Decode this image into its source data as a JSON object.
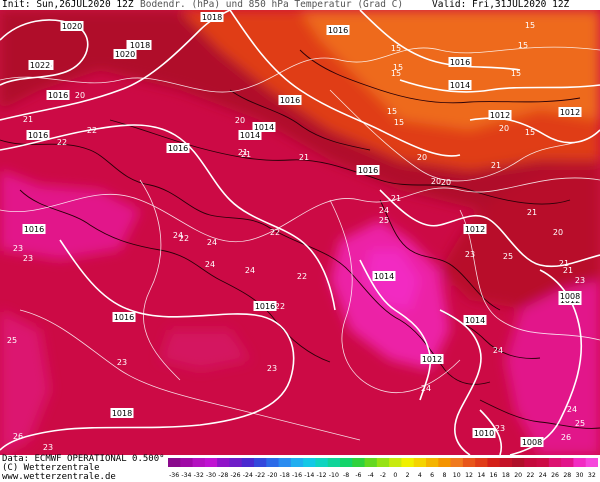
{
  "header": {
    "init": "Init: Sun,26JUL2020 12Z",
    "title": "Bodendr. (hPa) und 850 hPa Temperatur (Grad C)",
    "valid": "Valid: Fri,31JUL2020 12Z"
  },
  "footer": {
    "line1": "Data: ECMWF OPERATIONAL 0.500°",
    "line2": "(C) Wetterzentrale",
    "line3": "www.wetterzentrale.de"
  },
  "colors": {
    "base": "#cc0a45",
    "deep_red": "#b0102a",
    "orange": "#e8561a",
    "orange_light": "#f07a1e",
    "magenta": "#e2148a",
    "pink": "#f22cc2",
    "isobar": "#ffffff",
    "border": "#2a0008"
  },
  "scale": {
    "labels": [
      "-36",
      "-34",
      "-32",
      "-30",
      "-28",
      "-26",
      "-24",
      "-22",
      "-20",
      "-18",
      "-16",
      "-14",
      "-12",
      "-10",
      "-8",
      "-6",
      "-4",
      "-2",
      "0",
      "2",
      "4",
      "6",
      "8",
      "10",
      "12",
      "14",
      "16",
      "18",
      "20",
      "22",
      "24",
      "26",
      "28",
      "30",
      "32"
    ],
    "colors": [
      "#8a0a8c",
      "#a00aa6",
      "#b412c0",
      "#c014d2",
      "#9014c8",
      "#6e1ec8",
      "#4a2ad0",
      "#3448dc",
      "#2c6ae8",
      "#2a8cf0",
      "#20aef0",
      "#14c8e6",
      "#10d4c0",
      "#10d49a",
      "#14d46a",
      "#30d23c",
      "#64d820",
      "#96e214",
      "#c8ea10",
      "#f0f000",
      "#f4d400",
      "#f4b400",
      "#f49400",
      "#f07a1e",
      "#e8561a",
      "#e03c18",
      "#d42018",
      "#c41228",
      "#b0102a",
      "#c40a3c",
      "#cc0a45",
      "#dc1270",
      "#e2148a",
      "#f22cc2",
      "#f648dc"
    ]
  },
  "pressure_labels": [
    "1020",
    "1018",
    "1016",
    "1018",
    "1022",
    "1020",
    "1016",
    "1016",
    "1016",
    "1016",
    "1014",
    "1016",
    "1016",
    "1016",
    "1016",
    "1014",
    "1016",
    "1018",
    "1014",
    "1012",
    "1012",
    "1014",
    "1012",
    "1012",
    "1012",
    "1010",
    "1008",
    "1008",
    "1016",
    "1018",
    "1014"
  ],
  "temp_labels": [
    "15",
    "15",
    "15",
    "15",
    "15",
    "15",
    "15",
    "15",
    "15",
    "20",
    "20",
    "20",
    "20",
    "20",
    "20",
    "20",
    "21",
    "21",
    "21",
    "21",
    "21",
    "21",
    "21",
    "21",
    "21",
    "22",
    "22",
    "22",
    "22",
    "22",
    "22",
    "23",
    "23",
    "23",
    "23",
    "23",
    "23",
    "23",
    "23",
    "24",
    "24",
    "24",
    "24",
    "24",
    "24",
    "24",
    "24",
    "25",
    "25",
    "25",
    "25",
    "26",
    "26"
  ]
}
